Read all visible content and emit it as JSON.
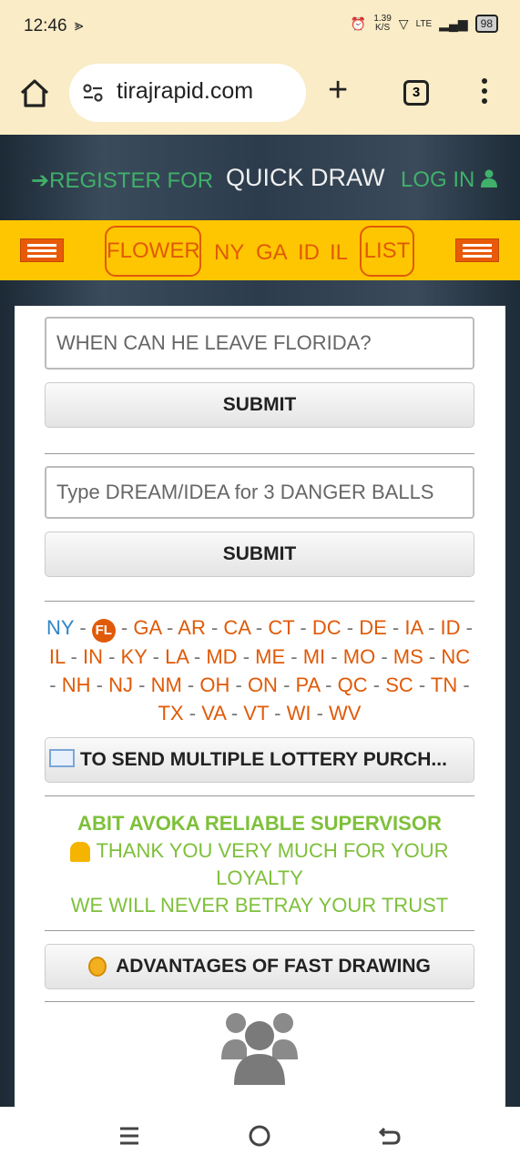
{
  "status_bar": {
    "time": "12:46",
    "net_speed_value": "1.39",
    "net_speed_unit": "K/S",
    "network": "LTE",
    "battery": "98"
  },
  "browser": {
    "url": "tirajrapid.com",
    "tab_count": "3"
  },
  "top_nav": {
    "register": "REGISTER FOR",
    "title": "QUICK DRAW",
    "login": "LOG IN"
  },
  "state_bar": {
    "flower": "FLOWER",
    "links": [
      "NY",
      "GA",
      "ID",
      "IL"
    ],
    "list": "LIST"
  },
  "form1": {
    "value": "WHEN CAN HE LEAVE FLORIDA?",
    "submit": "SUBMIT"
  },
  "form2": {
    "placeholder": "Type DREAM/IDEA for 3 DANGER BALLS",
    "submit": "SUBMIT"
  },
  "states": {
    "first": "NY",
    "current": "FL",
    "list": [
      "GA",
      "AR",
      "CA",
      "CT",
      "DC",
      "DE",
      "IA",
      "ID",
      "IL",
      "IN",
      "KY",
      "LA",
      "MD",
      "ME",
      "MI",
      "MO",
      "MS",
      "NC",
      "NH",
      "NJ",
      "NM",
      "OH",
      "ON",
      "PA",
      "QC",
      "SC",
      "TN",
      "TX",
      "VA",
      "VT",
      "WI",
      "WV"
    ]
  },
  "lottery_button": "TO SEND MULTIPLE LOTTERY PURCH...",
  "supervisor": {
    "title": "ABIT AVOKA RELIABLE SUPERVISOR",
    "thanks": "THANK YOU VERY MUCH FOR YOUR LOYALTY",
    "trust": "WE WILL NEVER BETRAY YOUR TRUST"
  },
  "advantages_button": "ADVANTAGES OF FAST DRAWING",
  "colors": {
    "accent_orange": "#e05a08",
    "state_bar_yellow": "#fec600",
    "link_green": "#40b06a",
    "supervisor_green": "#7ec03a",
    "browser_bg": "#f9ecc6"
  }
}
